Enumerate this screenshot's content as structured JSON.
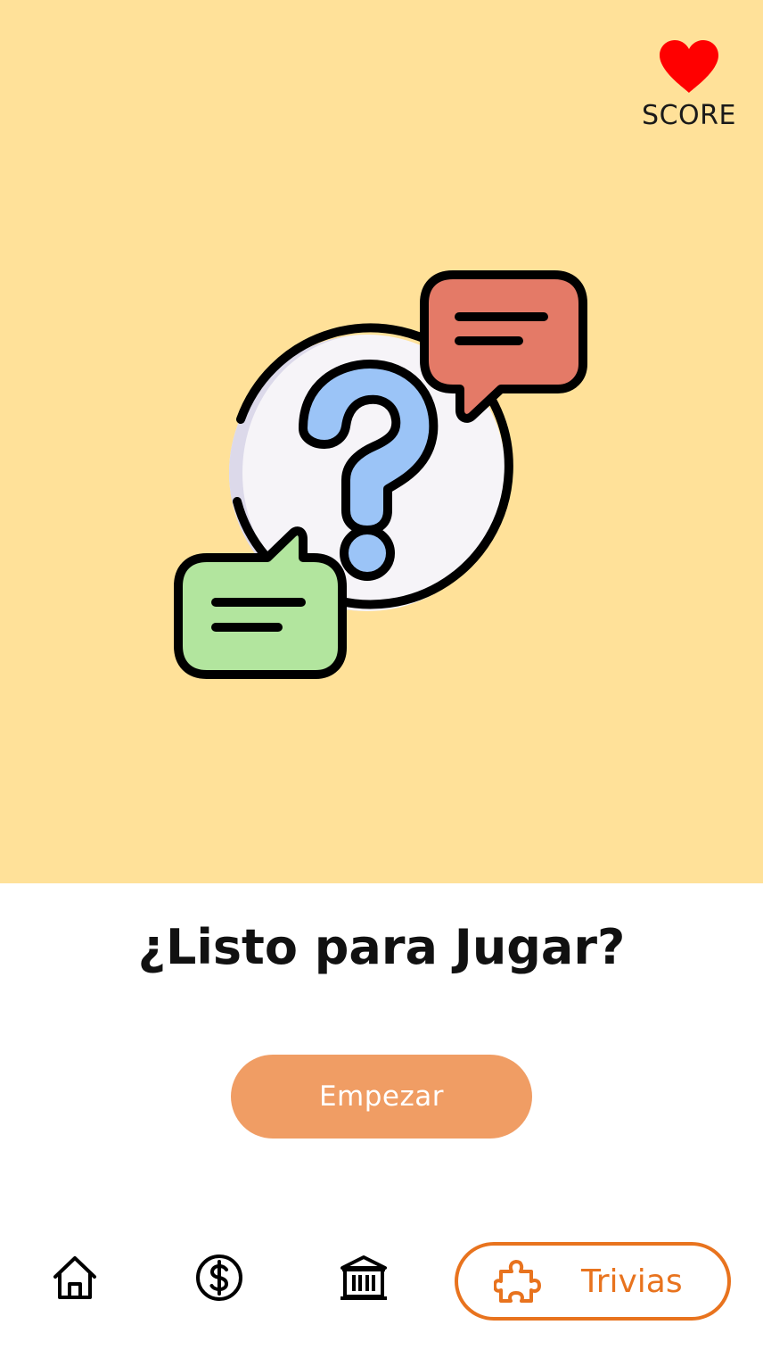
{
  "score": {
    "label": "SCORE",
    "icon": "heart-icon",
    "icon_color": "#FF0000"
  },
  "hero": {
    "background_color": "#FFE199",
    "illustration": "question-chat-illustration"
  },
  "main": {
    "title": "¿Listo para Jugar?",
    "start_button_label": "Empezar",
    "start_button_color": "#F09D64"
  },
  "nav": {
    "items": [
      {
        "icon": "home-icon"
      },
      {
        "icon": "dollar-icon"
      },
      {
        "icon": "bank-icon"
      },
      {
        "icon": "puzzle-icon",
        "label": "Trivias",
        "active": true
      }
    ],
    "active_color": "#E8731E"
  }
}
